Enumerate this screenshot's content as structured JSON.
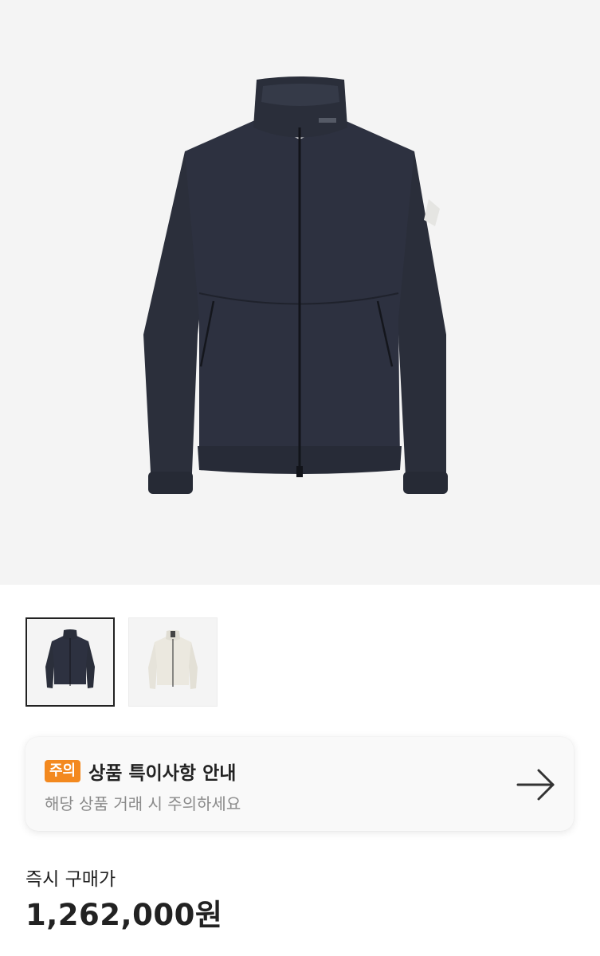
{
  "product": {
    "image_icon": "jacket-navy-image",
    "thumbnails": [
      {
        "icon": "jacket-navy-thumbnail",
        "selected": true
      },
      {
        "icon": "jacket-cream-thumbnail",
        "selected": false
      }
    ]
  },
  "notice": {
    "badge": "주의",
    "title": "상품 특이사항 안내",
    "subtitle": "해당 상품 거래 시 주의하세요",
    "arrow_icon": "arrow-right-icon",
    "badge_color": "#f3891f"
  },
  "price": {
    "label": "즉시 구매가",
    "value": "1,262,000원"
  }
}
